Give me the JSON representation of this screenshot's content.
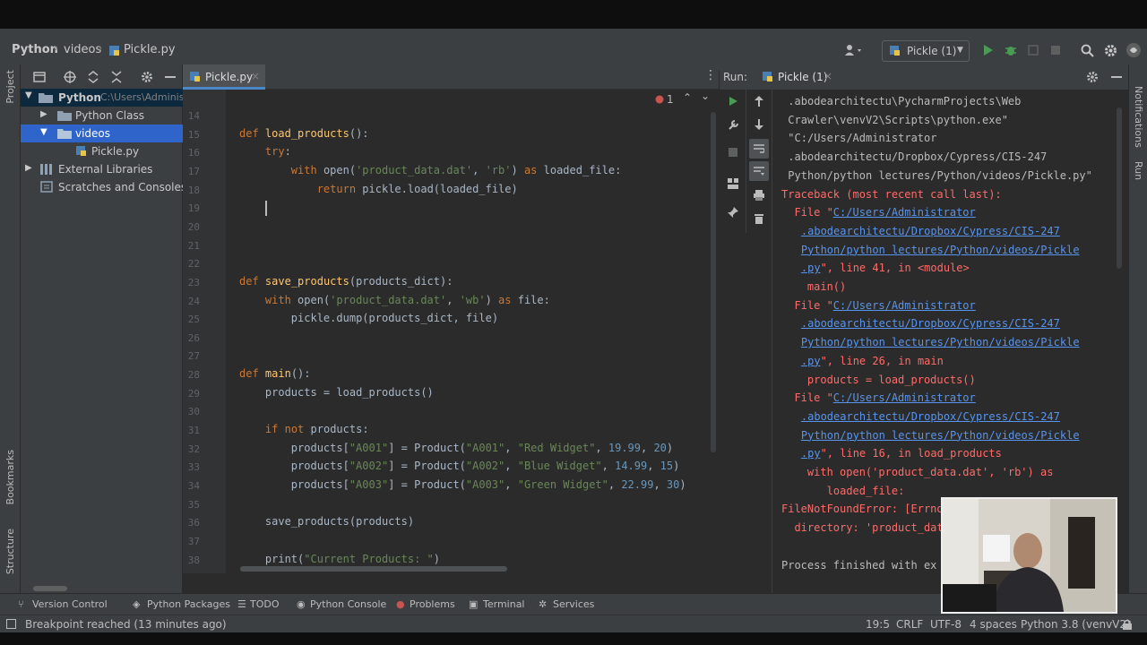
{
  "breadcrumbs": [
    "Python",
    "videos",
    "Pickle.py"
  ],
  "toolbar": {
    "run_config": "Pickle (1)"
  },
  "left_strip": {
    "project": "Project",
    "bookmarks": "Bookmarks",
    "structure": "Structure"
  },
  "right_strip": {
    "notifications": "Notifications",
    "run": "Run"
  },
  "project_tree": [
    {
      "label": "Python",
      "path": "C:\\Users\\Adminis"
    },
    {
      "label": "Python Class"
    },
    {
      "label": "videos"
    },
    {
      "label": "Pickle.py"
    },
    {
      "label": "External Libraries"
    },
    {
      "label": "Scratches and Consoles"
    }
  ],
  "editor": {
    "tab": "Pickle.py",
    "error_count": "1",
    "lines": [
      {
        "n": "14",
        "code": ""
      },
      {
        "n": "15",
        "code": "def load_products():"
      },
      {
        "n": "16",
        "code": "    try:"
      },
      {
        "n": "17",
        "code": "        with open('product_data.dat', 'rb') as loaded_file:"
      },
      {
        "n": "18",
        "code": "            return pickle.load(loaded_file)"
      },
      {
        "n": "19",
        "code": ""
      },
      {
        "n": "20",
        "code": ""
      },
      {
        "n": "21",
        "code": ""
      },
      {
        "n": "22",
        "code": ""
      },
      {
        "n": "23",
        "code": "def save_products(products_dict):"
      },
      {
        "n": "24",
        "code": "    with open('product_data.dat', 'wb') as file:"
      },
      {
        "n": "25",
        "code": "        pickle.dump(products_dict, file)"
      },
      {
        "n": "26",
        "code": ""
      },
      {
        "n": "27",
        "code": ""
      },
      {
        "n": "28",
        "code": "def main():"
      },
      {
        "n": "29",
        "code": "    products = load_products()"
      },
      {
        "n": "30",
        "code": ""
      },
      {
        "n": "31",
        "code": "    if not products:"
      },
      {
        "n": "32",
        "code": "        products[\"A001\"] = Product(\"A001\", \"Red Widget\", 19.99, 20)"
      },
      {
        "n": "33",
        "code": "        products[\"A002\"] = Product(\"A002\", \"Blue Widget\", 14.99, 15)"
      },
      {
        "n": "34",
        "code": "        products[\"A003\"] = Product(\"A003\", \"Green Widget\", 22.99, 30)"
      },
      {
        "n": "35",
        "code": ""
      },
      {
        "n": "36",
        "code": "    save_products(products)"
      },
      {
        "n": "37",
        "code": ""
      },
      {
        "n": "38",
        "code": "    print(\"Current Products: \")"
      }
    ]
  },
  "run": {
    "label": "Run:",
    "tab": "Pickle (1)",
    "output": [
      {
        "t": ".abodearchitectu\\PycharmProjects\\Web",
        "s": "w",
        "i": 1
      },
      {
        "t": "Crawler\\venvV2\\Scripts\\python.exe\"",
        "s": "w",
        "i": 1
      },
      {
        "t": "\"C:/Users/Administrator",
        "s": "w",
        "i": 1
      },
      {
        "t": ".abodearchitectu/Dropbox/Cypress/CIS-247",
        "s": "w",
        "i": 1
      },
      {
        "t": "Python/python lectures/Python/videos/Pickle.py\"",
        "s": "w",
        "i": 1
      },
      {
        "t": "Traceback (most recent call last):",
        "s": "r",
        "i": 0
      },
      {
        "t": "  File \"",
        "link": "C:/Users/Administrator",
        "s": "r",
        "i": 0
      },
      {
        "t": "",
        "link": ".abodearchitectu/Dropbox/Cypress/CIS-247",
        "s": "r",
        "i": 3
      },
      {
        "t": "",
        "link": "Python/python lectures/Python/videos/Pickle",
        "s": "r",
        "i": 3
      },
      {
        "t": "",
        "link": ".py",
        "after": "\", line 41, in <module>",
        "s": "r",
        "i": 3
      },
      {
        "t": "    main()",
        "s": "r",
        "i": 0
      },
      {
        "t": "  File \"",
        "link": "C:/Users/Administrator",
        "s": "r",
        "i": 0
      },
      {
        "t": "",
        "link": ".abodearchitectu/Dropbox/Cypress/CIS-247",
        "s": "r",
        "i": 3
      },
      {
        "t": "",
        "link": "Python/python lectures/Python/videos/Pickle",
        "s": "r",
        "i": 3
      },
      {
        "t": "",
        "link": ".py",
        "after": "\", line 26, in main",
        "s": "r",
        "i": 3
      },
      {
        "t": "    products = load_products()",
        "s": "r",
        "i": 0
      },
      {
        "t": "  File \"",
        "link": "C:/Users/Administrator",
        "s": "r",
        "i": 0
      },
      {
        "t": "",
        "link": ".abodearchitectu/Dropbox/Cypress/CIS-247",
        "s": "r",
        "i": 3
      },
      {
        "t": "",
        "link": "Python/python lectures/Python/videos/Pickle",
        "s": "r",
        "i": 3
      },
      {
        "t": "",
        "link": ".py",
        "after": "\", line 16, in load_products",
        "s": "r",
        "i": 3
      },
      {
        "t": "    with open('product_data.dat', 'rb') as",
        "s": "r",
        "i": 0
      },
      {
        "t": "      loaded_file:",
        "s": "r",
        "i": 1
      },
      {
        "t": "FileNotFoundError: [Errno",
        "s": "r",
        "i": 0
      },
      {
        "t": "  directory: 'product_dat",
        "s": "r",
        "i": 0
      },
      {
        "t": "",
        "s": "w",
        "i": 0
      },
      {
        "t": "Process finished with ex",
        "s": "w",
        "i": 0
      }
    ]
  },
  "bottom_tools": [
    "Version Control",
    "Python Packages",
    "TODO",
    "Python Console",
    "Problems",
    "Terminal",
    "Services"
  ],
  "status": {
    "message": "Breakpoint reached (13 minutes ago)",
    "position": "19:5",
    "line_sep": "CRLF",
    "encoding": "UTF-8",
    "indent": "4 spaces",
    "interpreter": "Python 3.8 (venvV2)"
  },
  "colors": {
    "accent": "#499c54",
    "error": "#ff6b68",
    "link": "#5894ec",
    "selection": "#0d293e"
  }
}
